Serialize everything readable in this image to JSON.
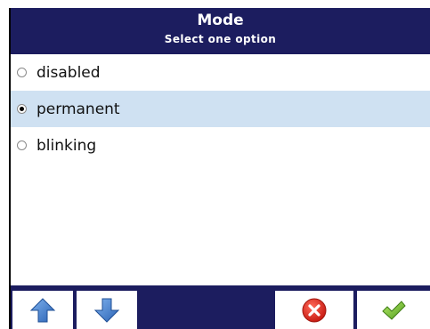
{
  "header": {
    "title": "Mode",
    "subtitle": "Select one option"
  },
  "options": [
    {
      "label": "disabled",
      "selected": false
    },
    {
      "label": "permanent",
      "selected": true
    },
    {
      "label": "blinking",
      "selected": false
    }
  ],
  "toolbar": {
    "buttons": [
      {
        "icon": "arrow-up-icon"
      },
      {
        "icon": "arrow-down-icon"
      },
      {
        "icon": "cancel-icon"
      },
      {
        "icon": "confirm-check-icon"
      }
    ]
  },
  "colors": {
    "header_bg": "#1c1d5f",
    "selected_row_bg": "#cfe1f2",
    "arrow_blue": "#3a78c9",
    "cancel_red": "#d8261c",
    "confirm_green": "#7cc43a"
  }
}
